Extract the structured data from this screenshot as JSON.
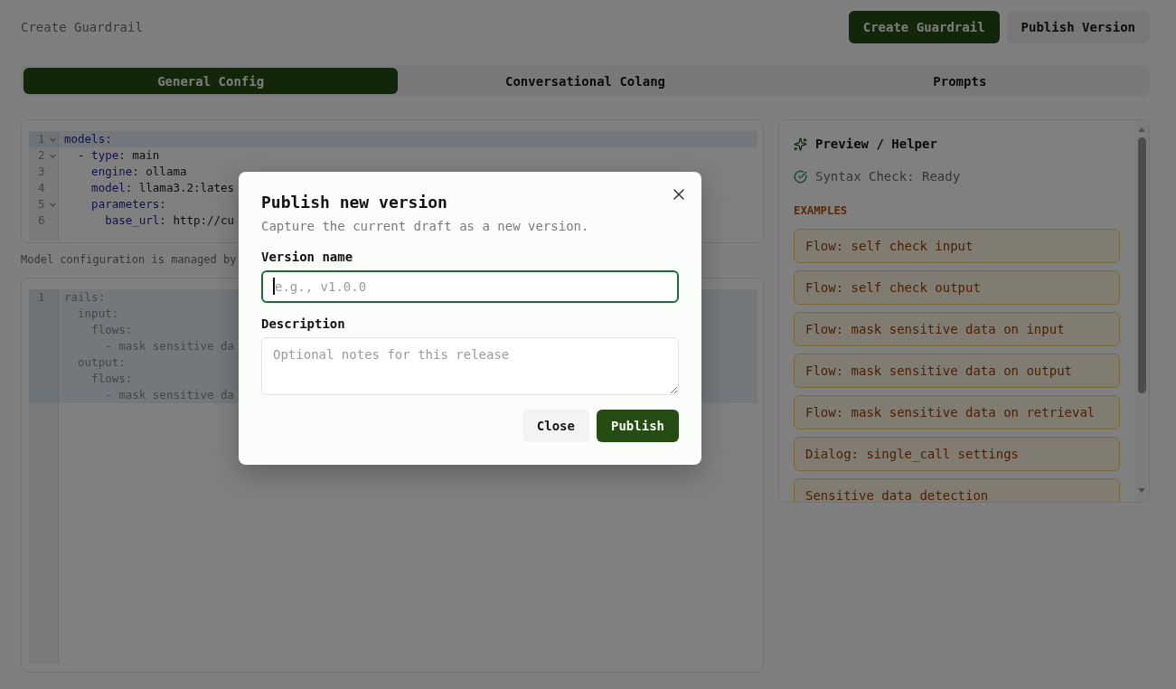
{
  "header": {
    "title": "Create Guardrail",
    "actions": [
      {
        "label": "Create Guardrail",
        "kind": "primary"
      },
      {
        "label": "Publish Version",
        "kind": "secondary"
      }
    ]
  },
  "tabs": [
    {
      "label": "General Config",
      "selected": true
    },
    {
      "label": "Conversational Colang",
      "selected": false
    },
    {
      "label": "Prompts",
      "selected": false
    }
  ],
  "model_editor": {
    "lines": [
      {
        "number": "1",
        "foldable": true,
        "active": true,
        "rows": [
          [
            {
              "text": "models",
              "kind": "key"
            },
            {
              "text": ":",
              "kind": "plain"
            }
          ]
        ]
      },
      {
        "number": "2",
        "foldable": true,
        "active": false,
        "rows": [
          [
            {
              "text": "  - ",
              "kind": "plain"
            },
            {
              "text": "type",
              "kind": "key"
            },
            {
              "text": ": main",
              "kind": "plain"
            }
          ]
        ]
      },
      {
        "number": "3",
        "foldable": false,
        "active": false,
        "rows": [
          [
            {
              "text": "    engine",
              "kind": "key"
            },
            {
              "text": ": ollama",
              "kind": "plain"
            }
          ]
        ]
      },
      {
        "number": "4",
        "foldable": false,
        "active": false,
        "rows": [
          [
            {
              "text": "    model",
              "kind": "key"
            },
            {
              "text": ": llama3.2:lates",
              "kind": "plain"
            }
          ]
        ]
      },
      {
        "number": "5",
        "foldable": true,
        "active": false,
        "rows": [
          [
            {
              "text": "    parameters",
              "kind": "key"
            },
            {
              "text": ":",
              "kind": "plain"
            }
          ]
        ]
      },
      {
        "number": "6",
        "foldable": false,
        "active": false,
        "rows": [
          [
            {
              "text": "      base_url",
              "kind": "key"
            },
            {
              "text": ": http://cu",
              "kind": "plain"
            }
          ]
        ]
      }
    ]
  },
  "model_note": "Model configuration is managed by",
  "rails_editor": {
    "lines": [
      {
        "number": "1",
        "foldable": false,
        "active": true,
        "rows": [
          [
            {
              "text": "rails:",
              "kind": "muted"
            }
          ],
          [
            {
              "text": "  input:",
              "kind": "muted"
            }
          ],
          [
            {
              "text": "    flows:",
              "kind": "muted"
            }
          ],
          [
            {
              "text": "      - mask sensitive da",
              "kind": "muted"
            }
          ],
          [
            {
              "text": "  output:",
              "kind": "muted"
            }
          ],
          [
            {
              "text": "    flows:",
              "kind": "muted"
            }
          ],
          [
            {
              "text": "      - mask sensitive da",
              "kind": "muted"
            }
          ]
        ]
      }
    ]
  },
  "helper": {
    "title": "Preview / Helper",
    "status": {
      "text": "Syntax Check: Ready",
      "ok": true
    },
    "section": "EXAMPLES",
    "examples": [
      "Flow: self check input",
      "Flow: self check output",
      "Flow: mask sensitive data on input",
      "Flow: mask sensitive data on output",
      "Flow: mask sensitive data on retrieval",
      "Dialog: single_call settings",
      "Sensitive data detection"
    ]
  },
  "dialog": {
    "title": "Publish new version",
    "subtitle": "Capture the current draft as a new version.",
    "fields": [
      {
        "label": "Version name",
        "kind": "input",
        "placeholder": "e.g., v1.0.0",
        "focused": true
      },
      {
        "label": "Description",
        "kind": "textarea",
        "placeholder": "Optional notes for this release",
        "focused": false
      }
    ],
    "actions": [
      {
        "label": "Close",
        "kind": "secondary"
      },
      {
        "label": "Publish",
        "kind": "primary"
      }
    ]
  }
}
